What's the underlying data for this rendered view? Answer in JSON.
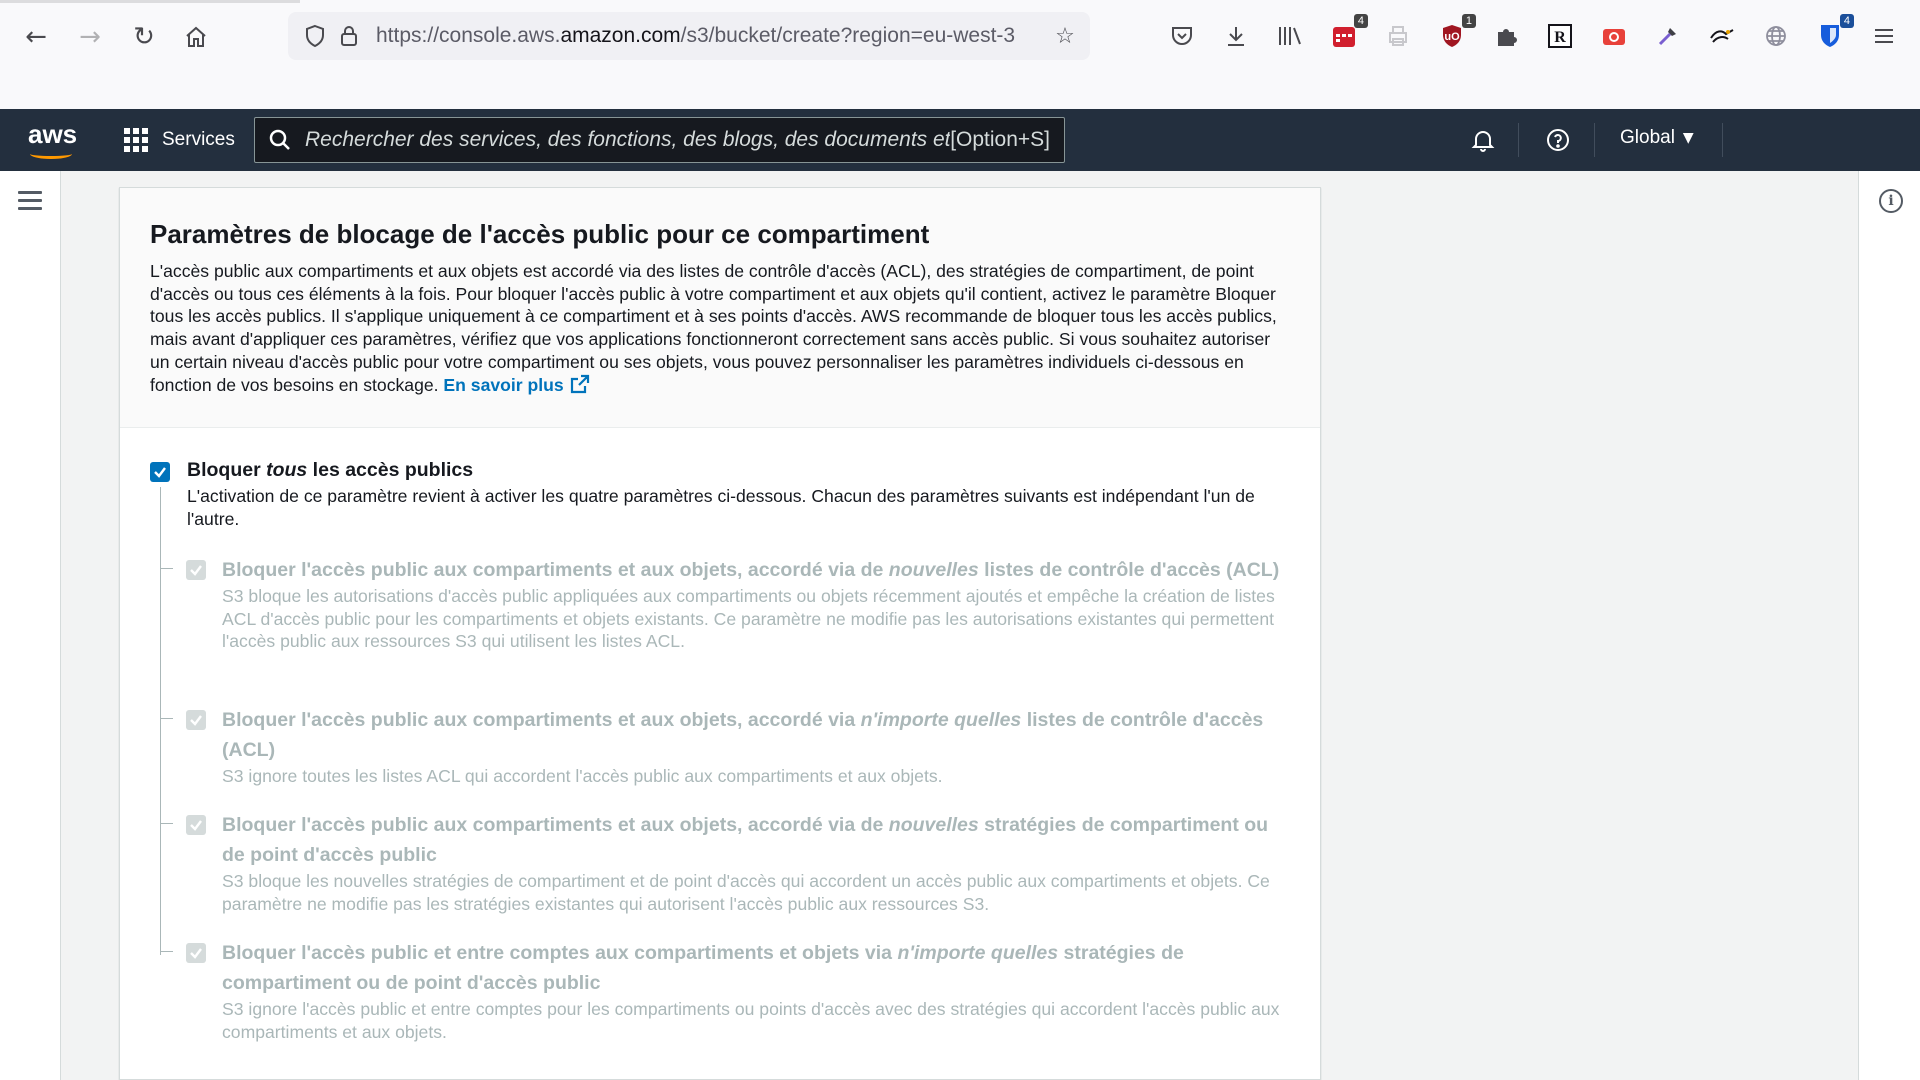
{
  "browser": {
    "url_scheme": "https://console.aws.",
    "url_host": "amazon.com",
    "url_path": "/s3/bucket/create?region=eu-west-3",
    "extensions": [
      {
        "name": "pocket-icon",
        "badge": ""
      },
      {
        "name": "download-icon",
        "badge": ""
      },
      {
        "name": "library-icon",
        "badge": ""
      },
      {
        "name": "calendar-extension-icon",
        "badge": "4"
      },
      {
        "name": "printer-extension-icon",
        "badge": ""
      },
      {
        "name": "ublock-icon",
        "badge": "1"
      },
      {
        "name": "puzzle-icon",
        "badge": ""
      },
      {
        "name": "r-extension-icon",
        "badge": "R"
      },
      {
        "name": "camera-extension-icon",
        "badge": ""
      },
      {
        "name": "eyedropper-icon",
        "badge": ""
      },
      {
        "name": "hands-extension-icon",
        "badge": ""
      },
      {
        "name": "globe-icon",
        "badge": ""
      },
      {
        "name": "bitwarden-icon",
        "badge": "4"
      },
      {
        "name": "menu-icon",
        "badge": ""
      }
    ]
  },
  "aws_nav": {
    "logo": "aws",
    "services_label": "Services",
    "search_placeholder": "Rechercher des services, des fonctions, des blogs, des documents et p",
    "search_shortcut": "[Option+S]",
    "region_label": "Global"
  },
  "card": {
    "title": "Paramètres de blocage de l'accès public pour ce compartiment",
    "description": "L'accès public aux compartiments et aux objets est accordé via des listes de contrôle d'accès (ACL), des stratégies de compartiment, de point d'accès ou tous ces éléments à la fois. Pour bloquer l'accès public à votre compartiment et aux objets qu'il contient, activez le paramètre Bloquer tous les accès publics. Il s'applique uniquement à ce compartiment et à ses points d'accès. AWS recommande de bloquer tous les accès publics, mais avant d'appliquer ces paramètres, vérifiez que vos applications fonctionneront correctement sans accès public. Si vous souhaitez autoriser un certain niveau d'accès public pour votre compartiment ou ses objets, vous pouvez personnaliser les paramètres individuels ci-dessous en fonction de vos besoins en stockage.",
    "learn_more": "En savoir plus"
  },
  "block_all": {
    "title_pre": "Bloquer ",
    "title_em": "tous",
    "title_post": " les accès publics",
    "description": "L'activation de ce paramètre revient à activer les quatre paramètres ci-dessous. Chacun des paramètres suivants est indépendant l'un de l'autre.",
    "checked": true
  },
  "sub_options": [
    {
      "title_pre": "Bloquer l'accès public aux compartiments et aux objets, accordé via de ",
      "title_em": "nouvelles",
      "title_post": " listes de contrôle d'accès (ACL)",
      "description": "S3 bloque les autorisations d'accès public appliquées aux compartiments ou objets récemment ajoutés et empêche la création de listes ACL d'accès public pour les compartiments et objets existants. Ce paramètre ne modifie pas les autorisations existantes qui permettent l'accès public aux ressources S3 qui utilisent les listes ACL.",
      "checked": true
    },
    {
      "title_pre": "Bloquer l'accès public aux compartiments et aux objets, accordé via ",
      "title_em": "n'importe quelles",
      "title_post": " listes de contrôle d'accès (ACL)",
      "description": "S3 ignore toutes les listes ACL qui accordent l'accès public aux compartiments et aux objets.",
      "checked": true
    },
    {
      "title_pre": "Bloquer l'accès public aux compartiments et aux objets, accordé via de ",
      "title_em": "nouvelles",
      "title_post": " stratégies de compartiment ou de point d'accès public",
      "description": "S3 bloque les nouvelles stratégies de compartiment et de point d'accès qui accordent un accès public aux compartiments et objets. Ce paramètre ne modifie pas les stratégies existantes qui autorisent l'accès public aux ressources S3.",
      "checked": true
    },
    {
      "title_pre": "Bloquer l'accès public et entre comptes aux compartiments et objets via ",
      "title_em": "n'importe quelles",
      "title_post": " stratégies de compartiment ou de point d'accès public",
      "description": "S3 ignore l'accès public et entre comptes pour les compartiments ou points d'accès avec des stratégies qui accordent l'accès public aux compartiments et aux objets.",
      "checked": true
    }
  ],
  "colors": {
    "aws_nav_bg": "#232f3e",
    "aws_orange": "#ff9900",
    "link_blue": "#0073bb",
    "disabled_text": "#aab7b8"
  }
}
